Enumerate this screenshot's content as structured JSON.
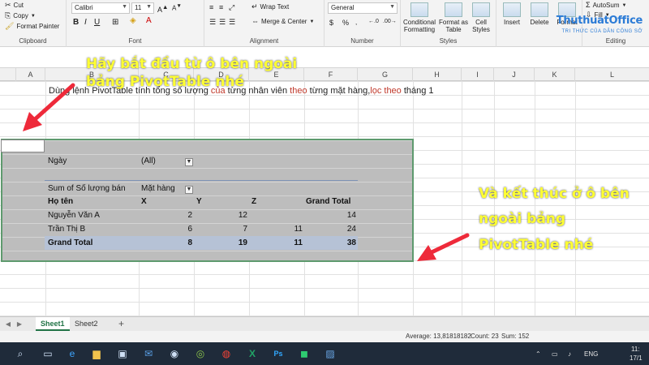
{
  "ribbon": {
    "clipboard": {
      "cut": "Cut",
      "copy": "Copy",
      "format_painter": "Format Painter",
      "group_label": "Clipboard"
    },
    "font": {
      "family": "Calibri",
      "size": "11",
      "group_label": "Font"
    },
    "alignment": {
      "wrap_text": "Wrap Text",
      "merge_center": "Merge & Center",
      "group_label": "Alignment"
    },
    "number": {
      "format": "General",
      "group_label": "Number"
    },
    "styles": {
      "conditional_formatting": "Conditional Formatting",
      "format_as_table": "Format as Table",
      "cell_styles": "Cell Styles",
      "group_label": "Styles"
    },
    "cells": {
      "insert": "Insert",
      "delete": "Delete",
      "format": "Format"
    },
    "editing": {
      "autosum": "AutoSum",
      "fill": "Fill",
      "group_label": "Editing"
    }
  },
  "logo": {
    "text": "ThuthuatOffice",
    "sub": "TRI THỨC CỦA DÂN CÔNG SỞ"
  },
  "columns": [
    "A",
    "B",
    "C",
    "D",
    "E",
    "F",
    "G",
    "H",
    "I",
    "J",
    "K",
    "L"
  ],
  "instruction": {
    "part1": "Dùng lệnh PivotTable tính tổng số lượng ",
    "cua": "của",
    "part2": " từng nhân viên ",
    "theo1": "theo",
    "part3": " từng mặt hàng,",
    "loc": "lọc theo",
    "part4": " tháng 1"
  },
  "pivot": {
    "filter_label": "Ngày",
    "filter_value": "(All)",
    "values_label": "Sum of Số lượng bán",
    "column_label": "Mặt hàng",
    "row_label": "Họ tên",
    "col_items": [
      "X",
      "Y",
      "Z",
      "Grand Total"
    ],
    "rows": [
      {
        "name": "Nguyễn Văn A",
        "x": "2",
        "y": "12",
        "z": "",
        "total": "14"
      },
      {
        "name": "Trần Thị B",
        "x": "6",
        "y": "7",
        "z": "11",
        "total": "24"
      }
    ],
    "grand": {
      "name": "Grand Total",
      "x": "8",
      "y": "19",
      "z": "11",
      "total": "38"
    }
  },
  "annotations": {
    "start_line1": "Hãy bắt đầu từ ô bên ngoài",
    "start_line2": "bảng PivotTable nhé",
    "end_line1": "Và kết thúc ở ô bên",
    "end_line2": "ngoài bảng",
    "end_line3": "PivotTable nhé",
    "arrow_color": "#ee2a3a",
    "text_color": "#ffff33"
  },
  "sheets": [
    "Sheet1",
    "Sheet2"
  ],
  "add_sheet": "+",
  "status": {
    "average": "Average: 13,81818182",
    "count": "Count: 23",
    "sum": "Sum: 152"
  },
  "taskbar": {
    "lang": "ENG",
    "time": "11:",
    "date": "17/1"
  }
}
